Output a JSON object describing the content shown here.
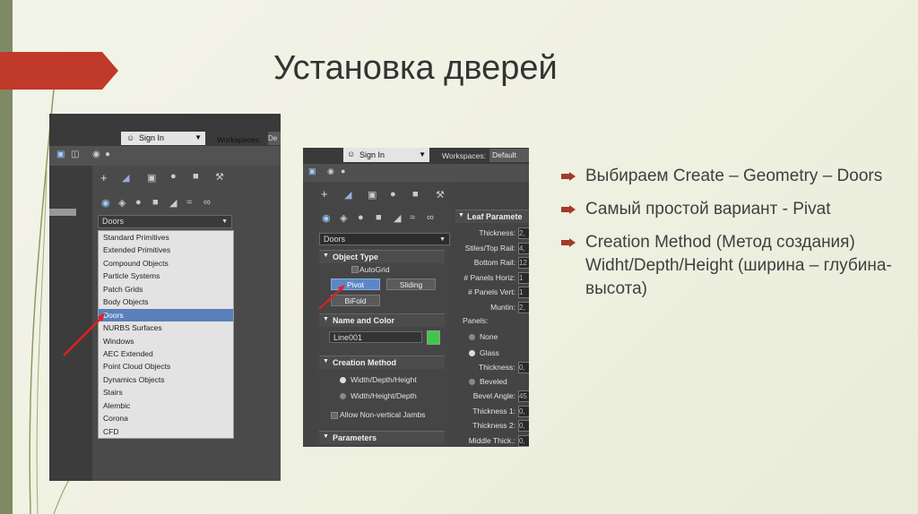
{
  "slide": {
    "title": "Установка дверей",
    "bullets": [
      "Выбираем Create – Geometry – Doors",
      "Самый простой вариант  - Pivat",
      "Creation Method (Метод создания) Widht/Depth/Height (ширина – глубина-высота)"
    ]
  },
  "colors": {
    "accent_ribbon": "#c0392b",
    "bullet_arrow": "#a33a2c",
    "selection": "#5a7fb9",
    "color_swatch": "#3ec84a"
  },
  "shot1": {
    "sign_in": "Sign In",
    "workspaces": "Workspaces:",
    "workspaces_value": "De",
    "dropdown_value": "Doors",
    "menu_items": [
      "Standard Primitives",
      "Extended Primitives",
      "Compound Objects",
      "Particle Systems",
      "Patch Grids",
      "Body Objects",
      "Doors",
      "NURBS Surfaces",
      "Windows",
      "AEC Extended",
      "Point Cloud Objects",
      "Dynamics Objects",
      "Stairs",
      "Alembic",
      "Corona",
      "CFD"
    ],
    "selected_item": "Doors"
  },
  "shot2": {
    "sign_in": "Sign In",
    "workspaces": "Workspaces:",
    "workspaces_value": "Default",
    "dropdown_value": "Doors",
    "object_type": {
      "header": "Object Type",
      "autogrid": "AutoGrid",
      "buttons": [
        "Pivot",
        "Sliding",
        "BiFold"
      ],
      "selected": "Pivot"
    },
    "name_and_color": {
      "header": "Name and Color",
      "name_value": "Line001"
    },
    "creation_method": {
      "header": "Creation Method",
      "options": [
        "Width/Depth/Height",
        "Width/Height/Depth"
      ],
      "checkbox": "Allow Non-vertical Jambs"
    },
    "parameters_header": "Parameters",
    "leaf_parameters": {
      "header": "Leaf Paramete",
      "fields": [
        {
          "label": "Thickness:",
          "value": "2,"
        },
        {
          "label": "Stiles/Top Rail:",
          "value": "4,"
        },
        {
          "label": "Bottom Rail:",
          "value": "12"
        },
        {
          "label": "# Panels Horiz:",
          "value": "1"
        },
        {
          "label": "# Panels Vert:",
          "value": "1"
        },
        {
          "label": "Muntin:",
          "value": "2,"
        }
      ],
      "panels_label": "Panels:",
      "panel_options": [
        "None",
        "Glass"
      ],
      "glass_thickness": {
        "label": "Thickness:",
        "value": "0,"
      },
      "beveled": "Beveled",
      "bevel_fields": [
        {
          "label": "Bevel Angle:",
          "value": "45"
        },
        {
          "label": "Thickness 1:",
          "value": "0,"
        },
        {
          "label": "Thickness 2:",
          "value": "0,"
        },
        {
          "label": "Middle Thick.:",
          "value": "0,"
        }
      ]
    }
  }
}
